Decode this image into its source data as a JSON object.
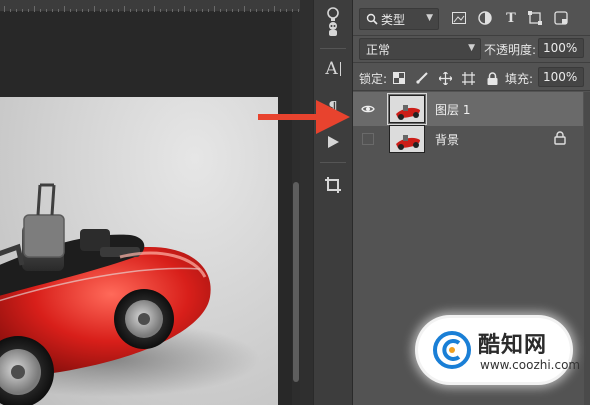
{
  "layers_panel": {
    "filter": {
      "kind_label": "类型"
    },
    "blend": {
      "mode": "正常",
      "opacity_label": "不透明度:",
      "opacity_value": "100%"
    },
    "lock": {
      "label": "锁定:",
      "fill_label": "填充:",
      "fill_value": "100%"
    },
    "layers": [
      {
        "name": "图层 1",
        "visible": true,
        "selected": true
      },
      {
        "name": "背景",
        "visible": false,
        "selected": false,
        "locked": true
      }
    ]
  },
  "tools": [
    {
      "icon": "adjust-tool-icon"
    },
    {
      "icon": "puppet-tool-icon"
    },
    {
      "icon": "character-panel-icon",
      "glyph": "A|"
    },
    {
      "icon": "paragraph-panel-icon"
    },
    {
      "icon": "play-action-icon",
      "glyph": "▶"
    },
    {
      "icon": "crop-tool-icon"
    }
  ],
  "annotation": {
    "arrow_color": "#e8432e"
  },
  "watermark": {
    "cn": "酷知网",
    "en": "www.coozhi.com",
    "logo_color": "#1a7fd6"
  },
  "colors": {
    "panel_bg": "#535353",
    "selected_layer": "#6a6a6a",
    "canvas_bg": "#282828"
  }
}
